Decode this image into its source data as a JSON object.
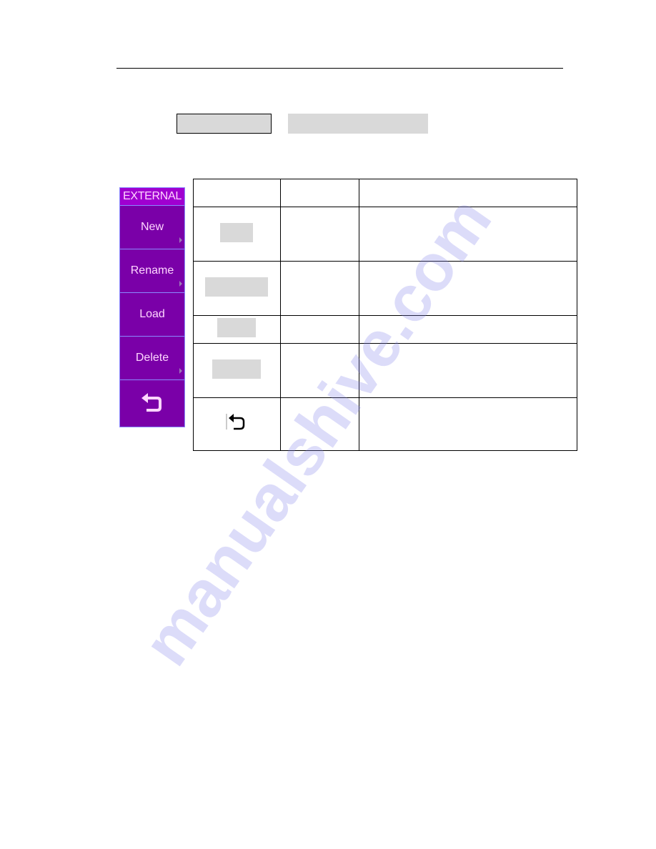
{
  "page": {
    "watermark": "manualshive.com"
  },
  "key_sequence": {
    "first_key": "",
    "second_key": ""
  },
  "menu": {
    "title": "EXTERNAL",
    "colors": {
      "background": "#7a00a8",
      "title_bg": "#a000d0",
      "text": "#ffd6ff",
      "border": "#8a8aff"
    },
    "items": [
      {
        "label": "New",
        "has_submenu": true
      },
      {
        "label": "Rename",
        "has_submenu": true
      },
      {
        "label": "Load",
        "has_submenu": false
      },
      {
        "label": "Delete",
        "has_submenu": true
      },
      {
        "label": "",
        "icon": "return-arrow-icon",
        "has_submenu": false
      }
    ]
  },
  "table": {
    "headers": [
      "",
      "",
      ""
    ],
    "rows": [
      {
        "key": "",
        "setting": "",
        "description": ""
      },
      {
        "key": "",
        "setting": "",
        "description": ""
      },
      {
        "key": "",
        "setting": "",
        "description": ""
      },
      {
        "key": "",
        "setting": "",
        "description": ""
      },
      {
        "key_icon": "return-arrow-icon",
        "setting": "",
        "description": ""
      }
    ]
  }
}
